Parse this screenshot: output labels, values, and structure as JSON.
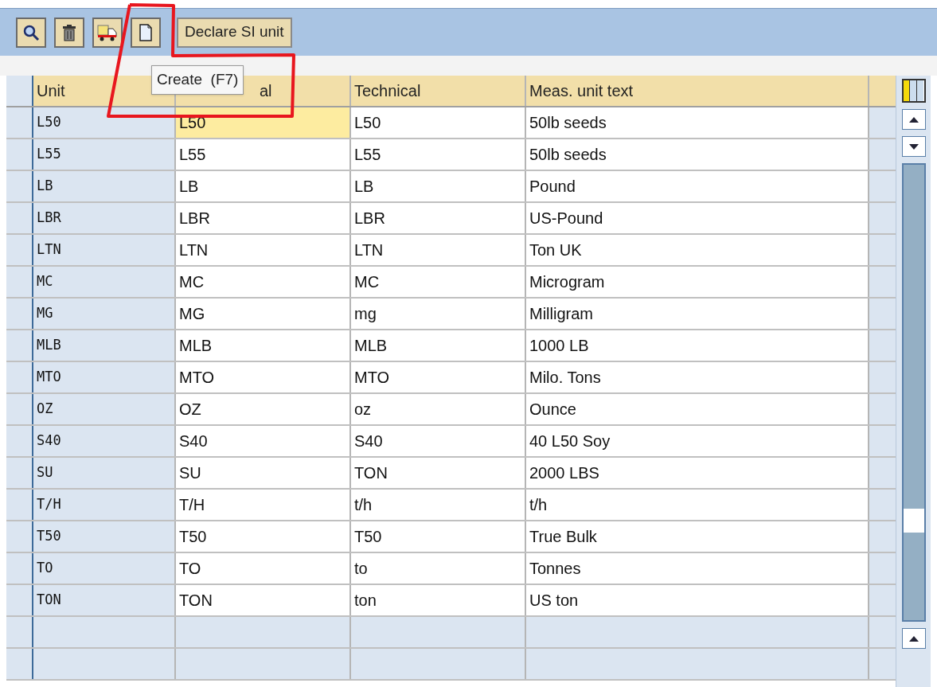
{
  "toolbar": {
    "text_button": "Declare SI unit"
  },
  "tooltip": "Create  (F7)",
  "table": {
    "columns": [
      "Unit",
      "al",
      "Technical",
      "Meas. unit text"
    ],
    "rows": [
      {
        "cells": [
          "L50",
          "L50",
          "L50",
          "50lb seeds"
        ],
        "focused": true
      },
      {
        "cells": [
          "L55",
          "L55",
          "L55",
          "50lb seeds"
        ],
        "focused": false
      },
      {
        "cells": [
          "LB",
          "LB",
          "LB",
          "Pound"
        ],
        "focused": false
      },
      {
        "cells": [
          "LBR",
          "LBR",
          "LBR",
          "US-Pound"
        ],
        "focused": false
      },
      {
        "cells": [
          "LTN",
          "LTN",
          "LTN",
          "Ton UK"
        ],
        "focused": false
      },
      {
        "cells": [
          "MC",
          "MC",
          "MC",
          "Microgram"
        ],
        "focused": false
      },
      {
        "cells": [
          "MG",
          "MG",
          "mg",
          "Milligram"
        ],
        "focused": false
      },
      {
        "cells": [
          "MLB",
          "MLB",
          "MLB",
          "1000 LB"
        ],
        "focused": false
      },
      {
        "cells": [
          "MTO",
          "MTO",
          "MTO",
          "Milo. Tons"
        ],
        "focused": false
      },
      {
        "cells": [
          "OZ",
          "OZ",
          "oz",
          "Ounce"
        ],
        "focused": false
      },
      {
        "cells": [
          "S40",
          "S40",
          "S40",
          "40 L50 Soy"
        ],
        "focused": false
      },
      {
        "cells": [
          "SU",
          "SU",
          "TON",
          "2000 LBS"
        ],
        "focused": false
      },
      {
        "cells": [
          "T/H",
          "T/H",
          "t/h",
          "t/h"
        ],
        "focused": false
      },
      {
        "cells": [
          "T50",
          "T50",
          "T50",
          "True Bulk"
        ],
        "focused": false
      },
      {
        "cells": [
          "TO",
          "TO",
          "to",
          "Tonnes"
        ],
        "focused": false
      },
      {
        "cells": [
          "TON",
          "TON",
          "ton",
          "US ton"
        ],
        "focused": false
      }
    ]
  }
}
